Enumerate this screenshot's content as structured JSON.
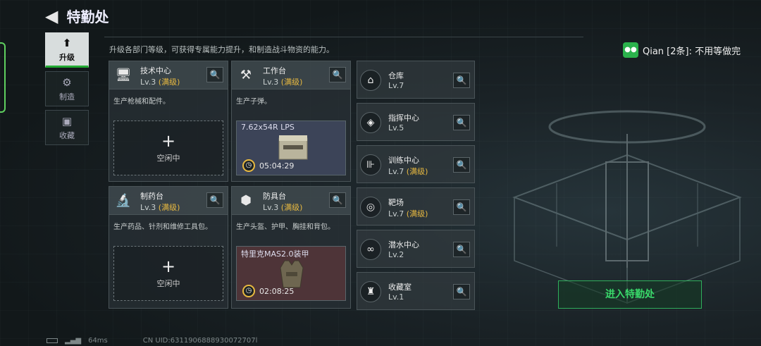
{
  "header": {
    "title": "特勤处",
    "description": "升级各部门等级，可获得专属能力提升，和制造战斗物资的能力。"
  },
  "sidebar": {
    "items": [
      {
        "label": "升级",
        "icon": "upgrade-icon",
        "active": true
      },
      {
        "label": "制造",
        "icon": "gear-icon"
      },
      {
        "label": "收藏",
        "icon": "collection-icon"
      }
    ]
  },
  "cards": [
    {
      "name": "技术中心",
      "level": "Lv.3",
      "status": "(满级)",
      "description": "生产枪械和配件。",
      "slot_label": "空闲中"
    },
    {
      "name": "工作台",
      "level": "Lv.3",
      "status": "(满级)",
      "description": "生产子弹。",
      "product": "7.62x54R LPS",
      "timer": "05:04:29"
    },
    {
      "name": "制药台",
      "level": "Lv.3",
      "status": "(满级)",
      "description": "生产药品、针剂和维修工具包。",
      "slot_label": "空闲中"
    },
    {
      "name": "防具台",
      "level": "Lv.3",
      "status": "(满级)",
      "description": "生产头盔、护甲、胸挂和背包。",
      "product": "特里克MAS2.0装甲",
      "timer": "02:08:25"
    }
  ],
  "facilities": [
    {
      "name": "仓库",
      "level": "Lv.7",
      "status": ""
    },
    {
      "name": "指挥中心",
      "level": "Lv.5",
      "status": ""
    },
    {
      "name": "训练中心",
      "level": "Lv.7",
      "status": "(满级)"
    },
    {
      "name": "靶场",
      "level": "Lv.7",
      "status": "(满级)"
    },
    {
      "name": "潜水中心",
      "level": "Lv.2",
      "status": ""
    },
    {
      "name": "收藏室",
      "level": "Lv.1",
      "status": ""
    }
  ],
  "notification": {
    "text": "Qian [2条]: 不用等做完"
  },
  "enter_button": "进入特勤处",
  "status": {
    "ping": "64ms",
    "uid": "CN UID:6311906888930072707l"
  },
  "colors": {
    "accent_green": "#39d86a",
    "max_level": "#e8b940"
  }
}
